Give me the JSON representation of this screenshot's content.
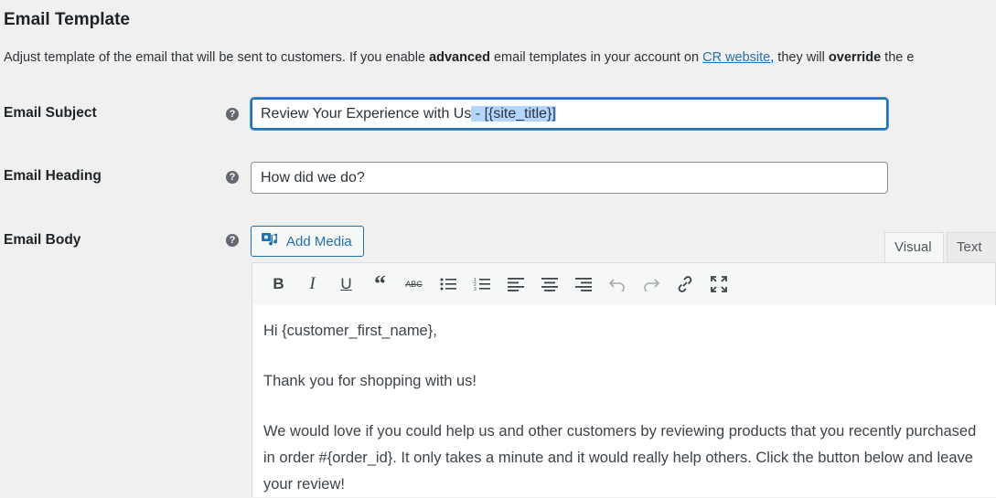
{
  "section": {
    "title": "Email Template",
    "intro_part1": "Adjust template of the email that will be sent to customers. If you enable ",
    "intro_bold1": "advanced",
    "intro_part2": " email templates in your account on ",
    "intro_link": "CR website",
    "intro_part3": ", they will ",
    "intro_bold2": "override",
    "intro_part4": " the e"
  },
  "fields": {
    "subject": {
      "label": "Email Subject",
      "value_unselected": "Review Your Experience with Us",
      "value_selected": " - [{site_title}]"
    },
    "heading": {
      "label": "Email Heading",
      "value": "How did we do?"
    },
    "body": {
      "label": "Email Body",
      "add_media_label": "Add Media",
      "tabs": [
        "Visual",
        "Text"
      ],
      "toolbar_icons": [
        "bold-icon",
        "italic-icon",
        "underline-icon",
        "blockquote-icon",
        "strikethrough-icon",
        "bulleted-list-icon",
        "numbered-list-icon",
        "align-left-icon",
        "align-center-icon",
        "align-right-icon",
        "undo-icon",
        "redo-icon",
        "link-icon",
        "fullscreen-icon"
      ],
      "paragraphs": [
        "Hi {customer_first_name},",
        "Thank you for shopping with us!",
        "We would love if you could help us and other customers by reviewing products that you recently purchased in order #{order_id}. It only takes a minute and it would really help others. Click the button below and leave your review!"
      ]
    }
  },
  "help_icon": "?"
}
